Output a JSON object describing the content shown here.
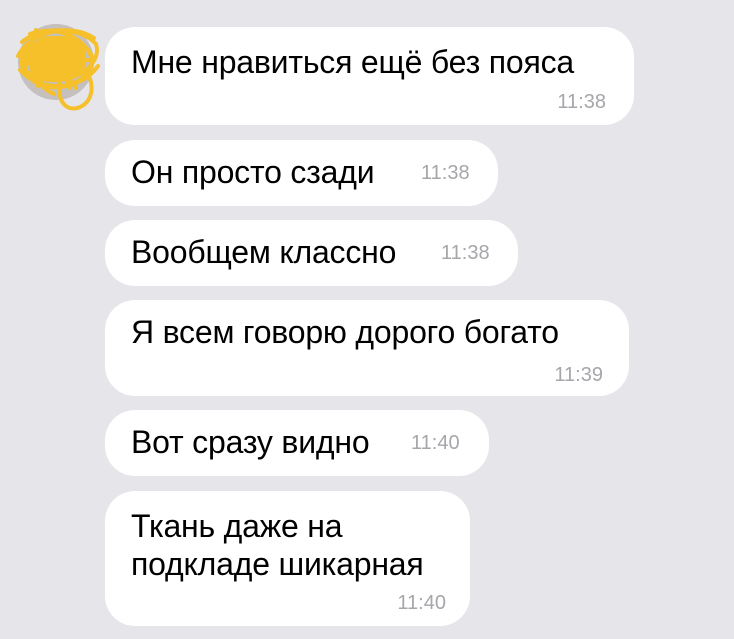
{
  "colors": {
    "background": "#e5e5ea",
    "bubble": "#ffffff",
    "text": "#000000",
    "timestamp": "#a6a6ab",
    "avatar_scribble": "#f5c02a"
  },
  "avatar": {
    "icon": "avatar-redacted-scribble-icon"
  },
  "messages": [
    {
      "text": "Мне нравиться ещё без пояса",
      "time": "11:38"
    },
    {
      "text": "Он просто сзади",
      "time": "11:38"
    },
    {
      "text": "Вообщем классно",
      "time": "11:38"
    },
    {
      "text": "Я всем говорю дорого богато",
      "time": "11:39"
    },
    {
      "text": "Вот сразу видно",
      "time": "11:40"
    },
    {
      "text": "Ткань даже на подкладе шикарная",
      "time": "11:40"
    }
  ]
}
